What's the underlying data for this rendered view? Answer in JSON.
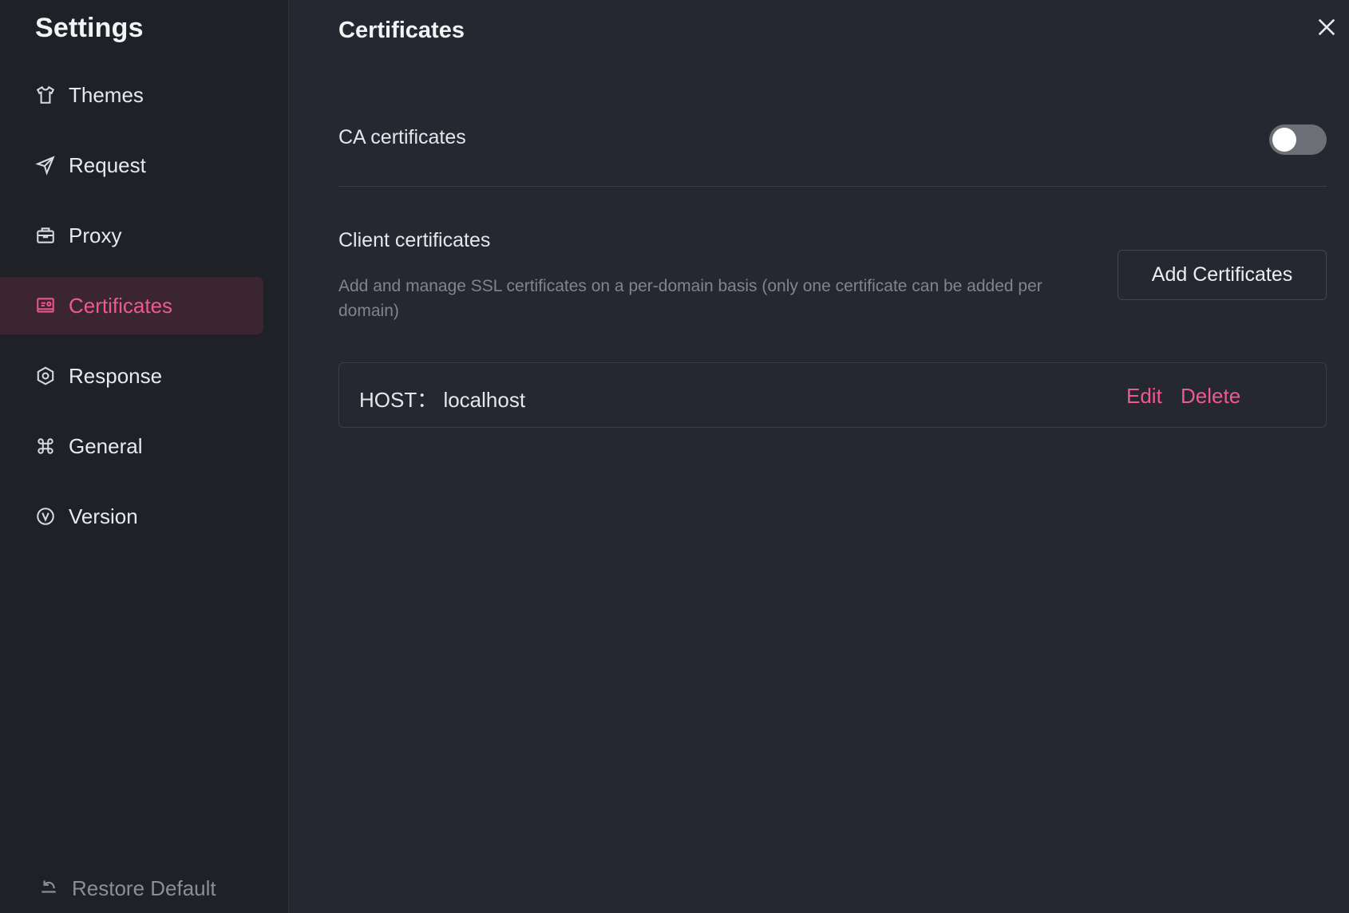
{
  "sidebar": {
    "title": "Settings",
    "items": [
      {
        "label": "Themes",
        "icon": "shirt-icon"
      },
      {
        "label": "Request",
        "icon": "send-icon"
      },
      {
        "label": "Proxy",
        "icon": "briefcase-icon"
      },
      {
        "label": "Certificates",
        "icon": "certificate-icon",
        "active": true
      },
      {
        "label": "Response",
        "icon": "hexagon-icon"
      },
      {
        "label": "General",
        "icon": "command-icon"
      },
      {
        "label": "Version",
        "icon": "version-icon"
      }
    ],
    "restore_label": "Restore Default"
  },
  "main": {
    "title": "Certificates",
    "ca": {
      "label": "CA certificates",
      "enabled": false
    },
    "client": {
      "title": "Client certificates",
      "description": "Add and manage SSL certificates on a per-domain basis (only one certificate can be added per domain)",
      "add_label": "Add Certificates"
    },
    "certificates": [
      {
        "host_text": "HOST： localhost",
        "edit_label": "Edit",
        "delete_label": "Delete"
      }
    ]
  },
  "colors": {
    "accent": "#ec5a8e",
    "active_bg": "#3b2630",
    "sidebar_bg": "#1f2127",
    "main_bg": "#252830"
  }
}
